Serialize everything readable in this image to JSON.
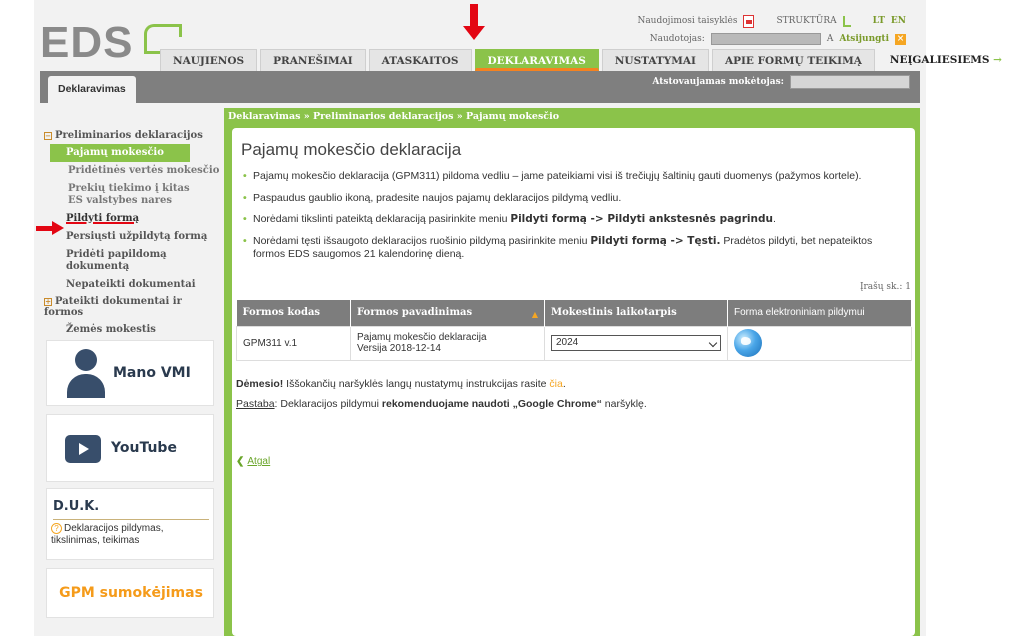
{
  "header": {
    "logo_text": "EDS",
    "links": {
      "rules": "Naudojimosi taisyklės",
      "structure": "STRUKTŪRA",
      "lang_lt": "LT",
      "lang_en": "EN"
    },
    "user_label": "Naudotojas:",
    "user_suffix": "A",
    "logout": "Atsijungti"
  },
  "nav": {
    "tabs": [
      "NAUJIENOS",
      "PRANEŠIMAI",
      "ATASKAITOS",
      "DEKLARAVIMAS",
      "NUSTATYMAI",
      "APIE FORMŲ TEIKIMĄ"
    ],
    "active_index": 3,
    "disabled_link": "NEĮGALIESIEMS",
    "disabled_arrow": "→"
  },
  "subbar": {
    "tab": "Deklaravimas",
    "taxpayer_label": "Atstovaujamas mokėtojas:"
  },
  "sidebar": {
    "group1": "Preliminarios deklaracijos",
    "group1_toggle": "−",
    "items": [
      "Pajamų mokesčio",
      "Pridėtinės vertės mokesčio",
      "Prekių tiekimo į kitas ES valstybes nares",
      "Pildyti formą",
      "Persiųsti užpildytą formą",
      "Pridėti papildomą dokumentą",
      "Nepateikti dokumentai"
    ],
    "group2": "Pateikti dokumentai ir formos",
    "group2_toggle": "+",
    "land_tax": "Žemės mokestis"
  },
  "cards": {
    "vmi": "Mano VMI",
    "youtube": "YouTube",
    "duk_title": "D.U.K.",
    "duk_q": "?",
    "duk_text": "Deklaracijos pildymas, tikslinimas, teikimas",
    "gpm": "GPM sumokėjimas"
  },
  "breadcrumb": "Deklaravimas » Preliminarios deklaracijos » Pajamų mokesčio",
  "main": {
    "title": "Pajamų mokesčio deklaracija",
    "bullet1": "Pajamų mokesčio deklaracija (GPM311) pildoma vedliu – jame pateikiami visi iš trečiųjų šaltinių gauti duomenys (pažymos kortele).",
    "bullet2": "Paspaudus gaublio ikoną, pradesite naujos pajamų deklaracijos pildymą vedliu.",
    "bullet3_pre": "Norėdami tikslinti pateiktą deklaraciją pasirinkite meniu ",
    "bullet3_bold": "Pildyti formą -> Pildyti ankstesnės pagrindu",
    "bullet3_post": ".",
    "bullet4_pre": "Norėdami tęsti išsaugoto deklaracijos ruošinio pildymą pasirinkite meniu ",
    "bullet4_bold": "Pildyti formą -> Tęsti.",
    "bullet4_post": " Pradėtos pildyti, bet nepateiktos formos EDS saugomos 21 kalendorinę dieną.",
    "record_count": "Įrašų sk.: 1"
  },
  "table": {
    "headers": [
      "Formos kodas",
      "Formos pavadinimas",
      "Mokestinis laikotarpis",
      "Forma elektroniniam pildymui"
    ],
    "sort_arrow": "▲",
    "rows": [
      {
        "code": "GPM311 v.1",
        "name": "Pajamų mokesčio deklaracija",
        "version": "Versija 2018-12-14",
        "period": "2024"
      }
    ]
  },
  "notes": {
    "attention_label": "Dėmesio!",
    "attention_text": " Iššokančių naršyklės langų nustatymų instrukcijas rasite ",
    "attention_link": "čia",
    "attention_end": ".",
    "remark_label": "Pastaba",
    "remark_text": ": Deklaracijos pildymui ",
    "remark_bold": "rekomenduojame naudoti „Google Chrome“",
    "remark_end": " naršyklę."
  },
  "back": {
    "chevron": "❮",
    "label": "Atgal"
  },
  "colors": {
    "green": "#8bc34a",
    "orange": "#f58220",
    "red_arrow": "#e30613",
    "gray_bar": "#7f7f7f"
  }
}
